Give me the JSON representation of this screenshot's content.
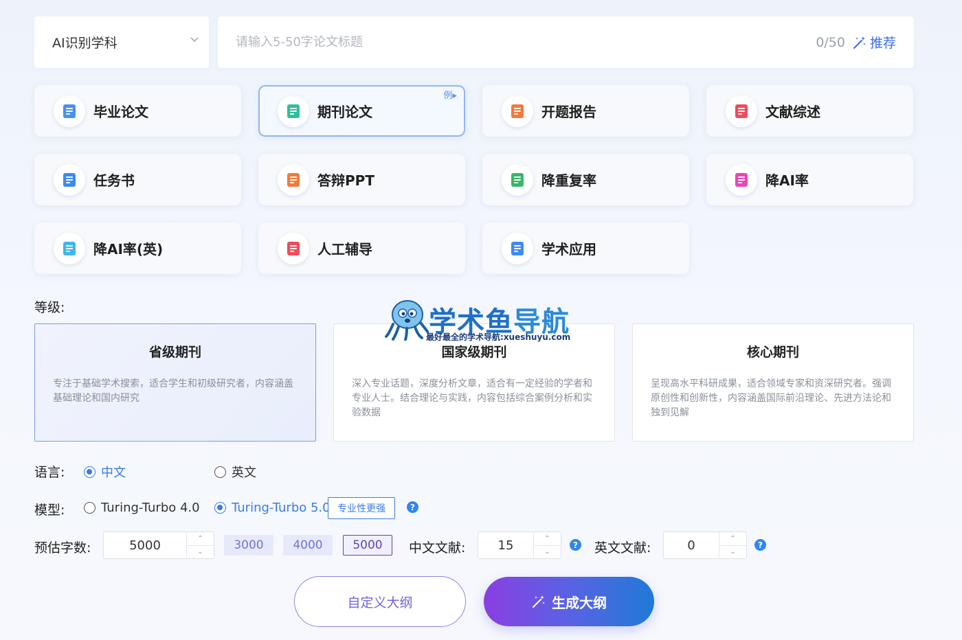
{
  "top": {
    "subject_select": "AI识别学科",
    "title_placeholder": "请输入5-50字论文标题",
    "title_value": "",
    "counter": "0/50",
    "recommend_label": "推荐"
  },
  "cards": [
    {
      "label": "毕业论文",
      "icon": "graduation-cap-icon",
      "color": "#4a8ff0"
    },
    {
      "label": "期刊论文",
      "icon": "journal-icon",
      "color": "#2fbf9b",
      "selected": true,
      "example": "例"
    },
    {
      "label": "开题报告",
      "icon": "calendar-report-icon",
      "color": "#f27a3b"
    },
    {
      "label": "文献综述",
      "icon": "document-review-icon",
      "color": "#ef4b5c"
    },
    {
      "label": "任务书",
      "icon": "task-book-icon",
      "color": "#3c8af0"
    },
    {
      "label": "答辩PPT",
      "icon": "ppt-icon",
      "color": "#f27a3b"
    },
    {
      "label": "降重复率",
      "icon": "reduce-duplicate-icon",
      "color": "#39b66a"
    },
    {
      "label": "降AI率",
      "icon": "reduce-ai-icon",
      "color": "#e449b6"
    },
    {
      "label": "降AI率(英)",
      "icon": "reduce-ai-en-icon",
      "color": "#3fb6e8"
    },
    {
      "label": "人工辅导",
      "icon": "human-tutor-icon",
      "color": "#ef4b5c"
    },
    {
      "label": "学术应用",
      "icon": "ai-app-icon",
      "color": "#3f8bf0"
    }
  ],
  "level": {
    "label": "等级:",
    "options": [
      {
        "title": "省级期刊",
        "desc": "专注于基础学术搜索，适合学生和初级研究者，内容涵盖基础理论和国内研究",
        "selected": true
      },
      {
        "title": "国家级期刊",
        "desc": "深入专业话题，深度分析文章，适合有一定经验的学者和专业人士。结合理论与实践，内容包括综合案例分析和实验数据"
      },
      {
        "title": "核心期刊",
        "desc": "呈现高水平科研成果，适合领域专家和资深研究者。强调原创性和创新性，内容涵盖国际前沿理论、先进方法论和独到见解"
      }
    ]
  },
  "language": {
    "label": "语言:",
    "options": [
      {
        "label": "中文",
        "selected": true
      },
      {
        "label": "英文"
      }
    ]
  },
  "model": {
    "label": "模型:",
    "options": [
      {
        "label": "Turing-Turbo 4.0"
      },
      {
        "label": "Turing-Turbo 5.0",
        "selected": true
      }
    ],
    "tag": "专业性更强"
  },
  "word_count": {
    "label": "预估字数:",
    "value": "5000",
    "presets": [
      {
        "label": "3000"
      },
      {
        "label": "4000"
      },
      {
        "label": "5000",
        "selected": true
      }
    ]
  },
  "cn_refs": {
    "label": "中文文献:",
    "value": "15"
  },
  "en_refs": {
    "label": "英文文献:",
    "value": "0"
  },
  "actions": {
    "custom_outline": "自定义大纲",
    "generate_outline": "生成大纲"
  },
  "watermark": {
    "title_a": "学术鱼",
    "title_b": "导航",
    "subtitle": "最好最全的学术导航:xueshuyu.com"
  },
  "help_glyph": "?",
  "colors": {
    "accent": "#3b7be8",
    "primary_gradient_start": "#8a3fe0",
    "primary_gradient_end": "#1f7ad6"
  }
}
